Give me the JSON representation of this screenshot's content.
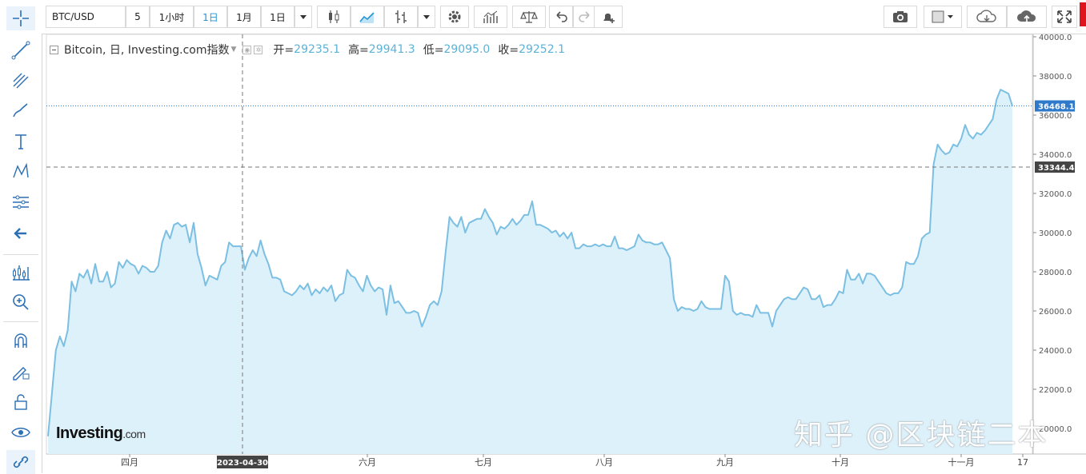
{
  "toolbar": {
    "symbol": "BTC/USD",
    "interval_value": "5",
    "interval_1h": "1小时",
    "interval_1d": "1日",
    "interval_1m": "1月",
    "interval_custom": "1日"
  },
  "legend": {
    "name": "Bitcoin, 日, Investing.com指数",
    "open_label": "开=",
    "open": "29235.1",
    "high_label": "高=",
    "high": "29941.3",
    "low_label": "低=",
    "low": "29095.0",
    "close_label": "收=",
    "close": "29252.1"
  },
  "logo": {
    "brand": "Investing",
    "suffix": ".com"
  },
  "watermark": "知乎 @区块链二本",
  "colors": {
    "line": "#7bbfe2",
    "fill": "#ddf1fb",
    "price_tag": "#2e79c9",
    "crosshair_tag": "#444444"
  },
  "chart_data": {
    "type": "area",
    "y_ticks": [
      "20000.0",
      "22000.0",
      "24000.0",
      "26000.0",
      "28000.0",
      "30000.0",
      "32000.0",
      "34000.0",
      "36000.0",
      "38000.0",
      "40000.0"
    ],
    "ylim": [
      19000,
      40500
    ],
    "x_ticks": [
      "四月",
      "六月",
      "七月",
      "八月",
      "九月",
      "十月",
      "十一月",
      "17"
    ],
    "crosshair_date": "2023-04-30",
    "crosshair_price": "33344.4",
    "last_price": "36468.1",
    "values": [
      19600,
      21800,
      24000,
      24700,
      24200,
      25000,
      27500,
      27000,
      27900,
      27700,
      28100,
      27400,
      28400,
      27500,
      27500,
      28000,
      27200,
      27400,
      28500,
      28200,
      28600,
      28400,
      28300,
      27900,
      28300,
      28200,
      28000,
      28000,
      28300,
      29500,
      30100,
      29700,
      30400,
      30500,
      30300,
      30400,
      29500,
      30500,
      28900,
      28200,
      27300,
      27800,
      27700,
      27600,
      28300,
      28500,
      29500,
      29300,
      29300,
      29300,
      28100,
      28700,
      29100,
      28800,
      29600,
      28900,
      28400,
      27700,
      27700,
      27600,
      27000,
      26900,
      26800,
      27000,
      27300,
      27100,
      27400,
      26800,
      27100,
      26900,
      27200,
      27000,
      27300,
      26500,
      26800,
      26900,
      28100,
      27800,
      27700,
      27300,
      27000,
      27800,
      27300,
      27000,
      27200,
      27100,
      25800,
      27300,
      26400,
      26500,
      26200,
      25900,
      25900,
      26000,
      25900,
      25200,
      25700,
      26300,
      26500,
      26300,
      27000,
      29000,
      30800,
      30500,
      30300,
      30800,
      30000,
      30500,
      30600,
      30700,
      30700,
      31200,
      30800,
      30500,
      29900,
      30300,
      30200,
      30400,
      30700,
      30400,
      30600,
      30900,
      30900,
      31600,
      30400,
      30400,
      30300,
      30200,
      30000,
      30100,
      29800,
      30000,
      29700,
      30000,
      29200,
      29200,
      29400,
      29300,
      29300,
      29400,
      29300,
      29400,
      29300,
      29300,
      29800,
      29200,
      29200,
      29100,
      29200,
      29300,
      29900,
      29600,
      29500,
      29500,
      29400,
      29400,
      29500,
      29100,
      28700,
      26600,
      26000,
      26200,
      26100,
      26100,
      26000,
      26100,
      26500,
      26200,
      26100,
      26100,
      26100,
      26100,
      27800,
      27500,
      26000,
      25800,
      25900,
      25800,
      25800,
      25700,
      26300,
      25900,
      25900,
      25900,
      25200,
      26000,
      26300,
      26600,
      26700,
      26600,
      26600,
      26900,
      27200,
      27100,
      26600,
      26600,
      26800,
      26200,
      26300,
      26300,
      26600,
      27000,
      26900,
      28100,
      27600,
      27600,
      27900,
      27400,
      27900,
      27900,
      27800,
      27500,
      27200,
      26900,
      26800,
      26900,
      26900,
      27200,
      28500,
      28400,
      28400,
      28800,
      29700,
      29900,
      30000,
      33500,
      34500,
      34200,
      34000,
      34100,
      34500,
      34400,
      34800,
      35500,
      35000,
      34800,
      35100,
      35000,
      35200,
      35500,
      35800,
      36800,
      37300,
      37200,
      37100,
      36468
    ]
  }
}
